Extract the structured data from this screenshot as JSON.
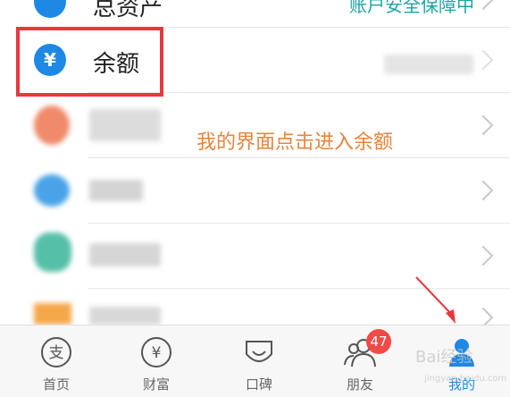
{
  "top_row": {
    "label": "总资产",
    "right_text": "账户安全保障中"
  },
  "balance_row": {
    "icon_text": "¥",
    "label": "余额"
  },
  "annotation": "我的界面点击进入余额",
  "tabs": [
    {
      "label": "首页",
      "icon": "alipay-home-icon"
    },
    {
      "label": "财富",
      "icon": "yen-circle-icon"
    },
    {
      "label": "口碑",
      "icon": "koubei-icon"
    },
    {
      "label": "朋友",
      "icon": "friends-icon",
      "badge": "47"
    },
    {
      "label": "我的",
      "icon": "person-icon",
      "active": true
    }
  ],
  "watermark": {
    "main": "Bai经验",
    "sub": "jingyan.baidu.com"
  },
  "colors": {
    "accent": "#1e88e5",
    "highlight": "#e8383d",
    "annotation": "#e8833a",
    "badge": "#f04a46"
  }
}
